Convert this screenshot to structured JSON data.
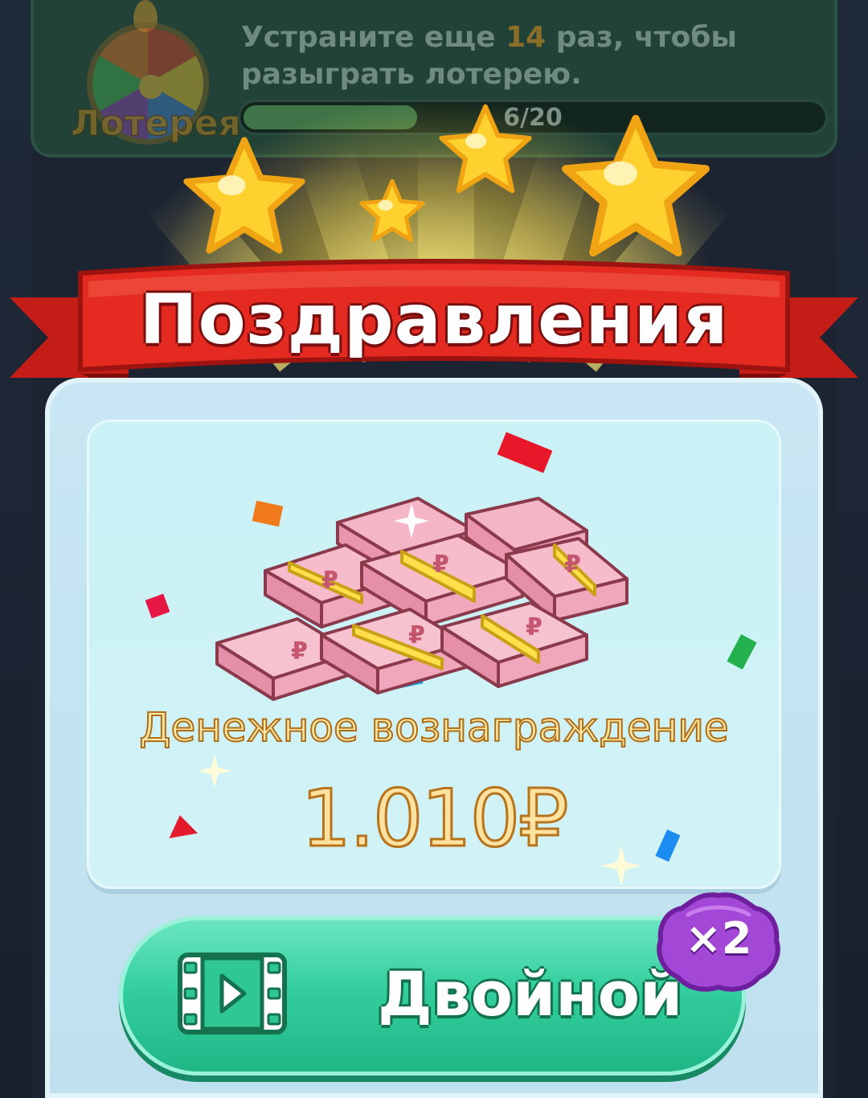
{
  "lottery": {
    "message_prefix": "Устраните еще",
    "remaining": "14",
    "message_suffix": "раз, чтобы разыграть лотерею.",
    "label": "Лотерея",
    "progress_text": "6/20",
    "progress_fraction": 0.3
  },
  "popup": {
    "title": "Поздравления",
    "reward_label": "Денежное вознаграждение",
    "reward_amount": "1.010₽",
    "reward_icon": "money-stack-icon",
    "button_label": "Двойной",
    "button_icon": "video-play-icon",
    "multiplier_badge": "×2"
  },
  "colors": {
    "ribbon": "#e0261f",
    "button": "#34cf9e",
    "badge": "#a347d6",
    "reward_text": "#ffe2a0"
  }
}
